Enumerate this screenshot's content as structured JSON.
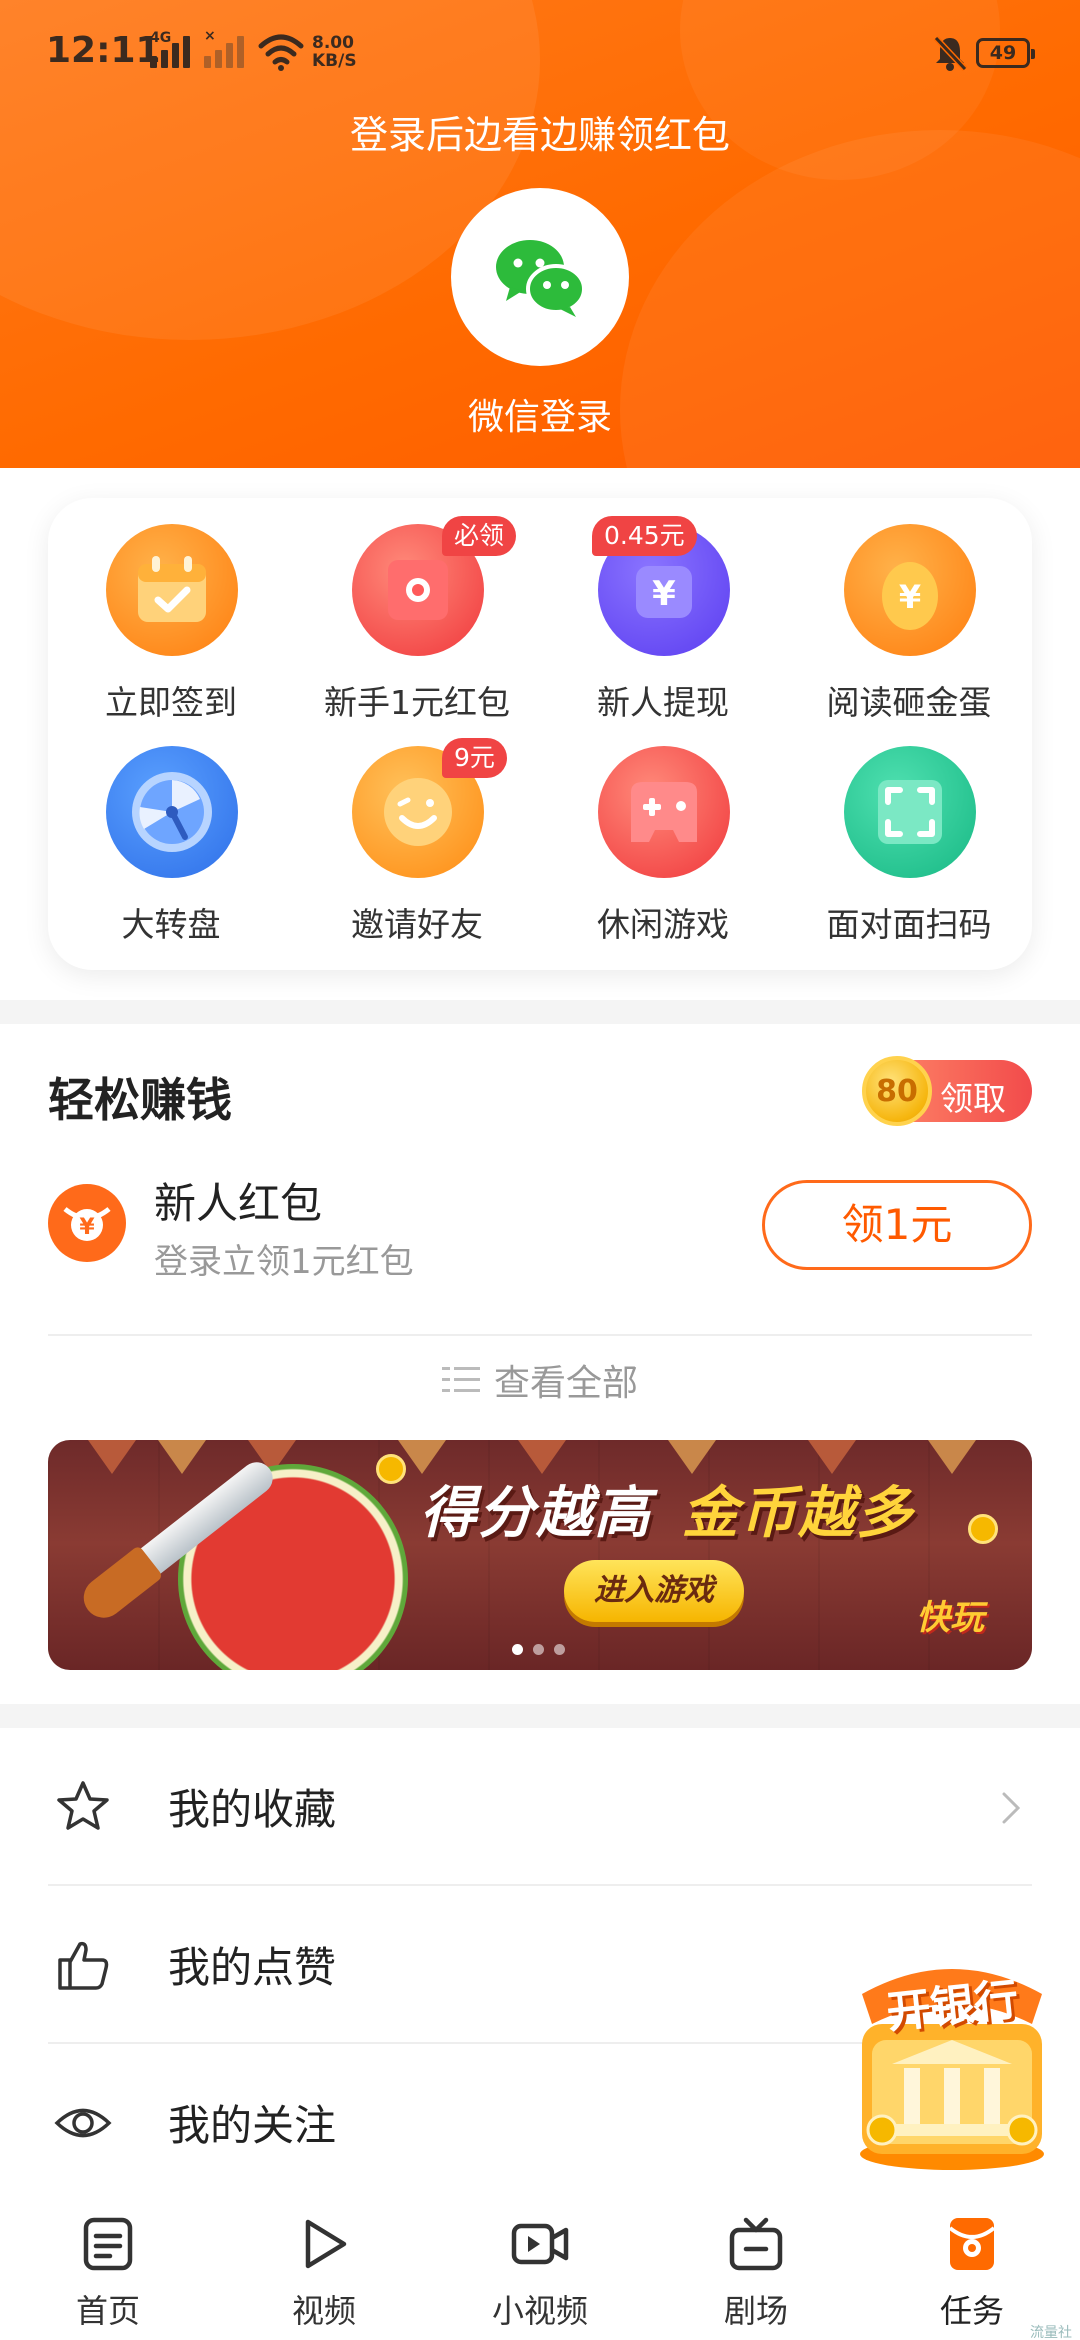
{
  "status_bar": {
    "time": "12:11",
    "net_tag_1": "4G",
    "net_tag_2": "×",
    "speed_value": "8.00",
    "speed_unit": "KB/S",
    "battery": "49"
  },
  "header": {
    "login_prompt": "登录后边看边赚领红包",
    "wechat_login_label": "微信登录",
    "bg_color": "#ff6a00"
  },
  "grid": {
    "items": [
      {
        "label": "立即签到",
        "icon": "calendar-check-icon",
        "badge": ""
      },
      {
        "label": "新手1元红包",
        "icon": "red-envelope-icon",
        "badge": "必领"
      },
      {
        "label": "新人提现",
        "icon": "yuan-wallet-icon",
        "badge": "0.45元"
      },
      {
        "label": "阅读砸金蛋",
        "icon": "golden-egg-icon",
        "badge": ""
      },
      {
        "label": "大转盘",
        "icon": "spin-wheel-icon",
        "badge": ""
      },
      {
        "label": "邀请好友",
        "icon": "smile-face-icon",
        "badge": "9元"
      },
      {
        "label": "休闲游戏",
        "icon": "gamepad-icon",
        "badge": ""
      },
      {
        "label": "面对面扫码",
        "icon": "scan-qr-icon",
        "badge": ""
      }
    ]
  },
  "earn": {
    "title": "轻松赚钱",
    "claim_coin": "80",
    "claim_label": "领取",
    "task": {
      "name": "新人红包",
      "desc": "登录立领1元红包",
      "button": "领1元"
    },
    "view_all": "查看全部",
    "banner": {
      "headline_1": "得分越高",
      "headline_2": "金币越多",
      "button": "进入游戏",
      "logo": "快玩",
      "slides": 3,
      "active_slide": 1
    }
  },
  "list": {
    "items": [
      {
        "label": "我的收藏",
        "icon": "star-icon"
      },
      {
        "label": "我的点赞",
        "icon": "thumbs-up-icon"
      },
      {
        "label": "我的关注",
        "icon": "eye-icon"
      }
    ],
    "float_badge": "开银行"
  },
  "bottom_nav": {
    "items": [
      {
        "label": "首页",
        "icon": "home-doc-icon"
      },
      {
        "label": "视频",
        "icon": "play-icon"
      },
      {
        "label": "小视频",
        "icon": "video-camera-icon"
      },
      {
        "label": "剧场",
        "icon": "tv-icon"
      },
      {
        "label": "任务",
        "icon": "task-bag-icon"
      }
    ],
    "active": "任务",
    "accent_color": "#ff6a00"
  },
  "watermark": "流量社区"
}
